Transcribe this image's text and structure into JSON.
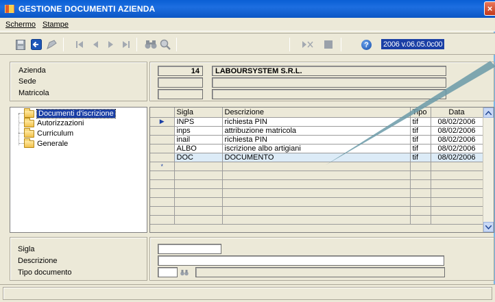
{
  "window": {
    "title": "GESTIONE DOCUMENTI AZIENDA",
    "close_label": "×"
  },
  "menu": {
    "items": [
      {
        "label": "Schermo"
      },
      {
        "label": "Stampe"
      }
    ]
  },
  "toolbar": {
    "icons": [
      "save-icon",
      "back-icon",
      "edit-icon",
      "first-record-icon",
      "prev-record-icon",
      "next-record-icon",
      "last-record-icon",
      "binoculars-icon",
      "magnifier-icon",
      "delete-record-icon",
      "stop-icon",
      "help-icon"
    ],
    "help_label": "?",
    "version_year": "2006",
    "version_text": "v.06.05.0c00"
  },
  "header_form": {
    "azienda_label": "Azienda",
    "sede_label": "Sede",
    "matricola_label": "Matricola",
    "azienda_code": "14",
    "azienda_name": "LABOURSYSTEM S.R.L.",
    "sede_code": "",
    "sede_name": "",
    "matricola_code": "",
    "matricola_name": ""
  },
  "tree": {
    "items": [
      {
        "label": "Documenti d'iscrizione",
        "selected": true
      },
      {
        "label": "Autorizzazioni"
      },
      {
        "label": "Curriculum"
      },
      {
        "label": "Generale"
      }
    ]
  },
  "grid": {
    "columns": [
      "Sigla",
      "Descrizione",
      "Tipo",
      "Data"
    ],
    "rows": [
      {
        "sigla": "INPS",
        "descrizione": "richiesta PIN",
        "tipo": "tif",
        "data": "08/02/2006",
        "marker": "▶"
      },
      {
        "sigla": "inps",
        "descrizione": "attribuzione matricola",
        "tipo": "tif",
        "data": "08/02/2006",
        "marker": ""
      },
      {
        "sigla": "inail",
        "descrizione": "richiesta PIN",
        "tipo": "tif",
        "data": "08/02/2006",
        "marker": ""
      },
      {
        "sigla": "ALBO",
        "descrizione": "iscrizione albo artigiani",
        "tipo": "tif",
        "data": "08/02/2006",
        "marker": ""
      },
      {
        "sigla": "DOC",
        "descrizione": "DOCUMENTO",
        "tipo": "tif",
        "data": "08/02/2006",
        "marker": ""
      }
    ],
    "new_row_marker": "*"
  },
  "detail_form": {
    "sigla_label": "Sigla",
    "descrizione_label": "Descrizione",
    "tipo_label": "Tipo documento",
    "sigla_value": "",
    "descrizione_value": "",
    "tipo_value": "",
    "tipo_desc_value": ""
  }
}
